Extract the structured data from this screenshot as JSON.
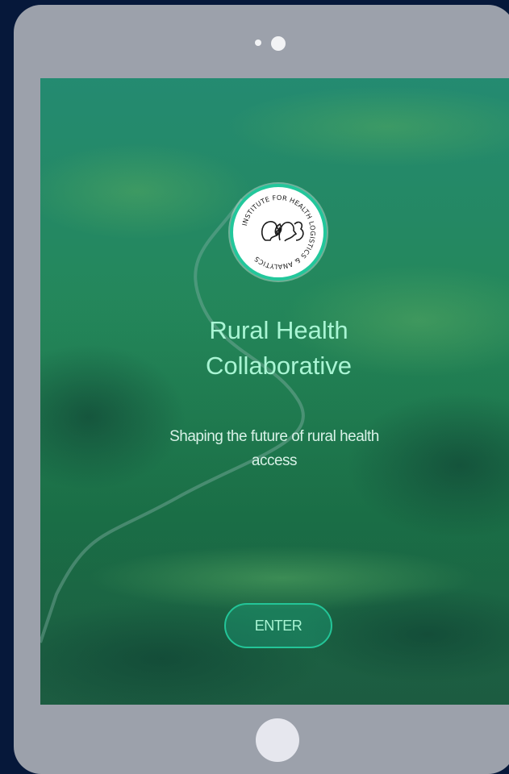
{
  "logo": {
    "ring_text": "INSTITUTE FOR HEALTH LOGISTICS & ANALYTICS",
    "accent_color": "#22c79b"
  },
  "hero": {
    "title_line1": "Rural Health",
    "title_line2": "Collaborative",
    "subtitle_line1": "Shaping the future of rural health",
    "subtitle_line2": "access"
  },
  "actions": {
    "enter_label": "ENTER"
  },
  "colors": {
    "device_frame": "#9ca1ab",
    "page_background": "#06183a",
    "title_text": "#a9f5d4",
    "button_border": "#23c598"
  },
  "icons": {
    "logo_glyph": "heads-leaf-squirrel-icon",
    "home": "home-button-icon",
    "camera": "camera-icon"
  }
}
